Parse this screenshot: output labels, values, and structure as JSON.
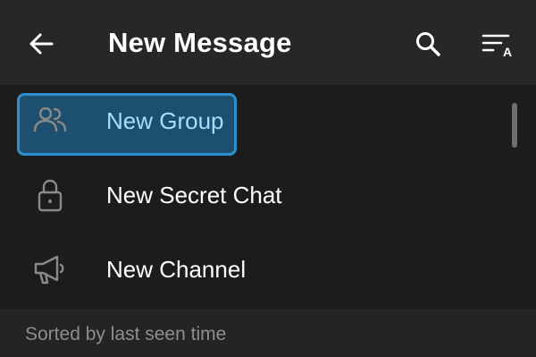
{
  "header": {
    "title": "New Message",
    "back_icon": "arrow-left-icon",
    "search_icon": "search-icon",
    "sort_icon": "sort-az-icon",
    "sort_icon_letter": "A"
  },
  "menu": {
    "items": [
      {
        "label": "New Group",
        "icon": "group-icon",
        "highlighted": true
      },
      {
        "label": "New Secret Chat",
        "icon": "lock-icon",
        "highlighted": false
      },
      {
        "label": "New Channel",
        "icon": "megaphone-icon",
        "highlighted": false
      }
    ]
  },
  "footer": {
    "note": "Sorted by last seen time"
  },
  "colors": {
    "header_bg": "#272727",
    "list_bg": "#1c1c1e",
    "footer_bg": "#242424",
    "highlight_border": "#2d8fd0",
    "highlight_fill": "#1d4f6e",
    "highlight_text": "#a9ddff",
    "icon_gray": "#8a8a8a"
  }
}
